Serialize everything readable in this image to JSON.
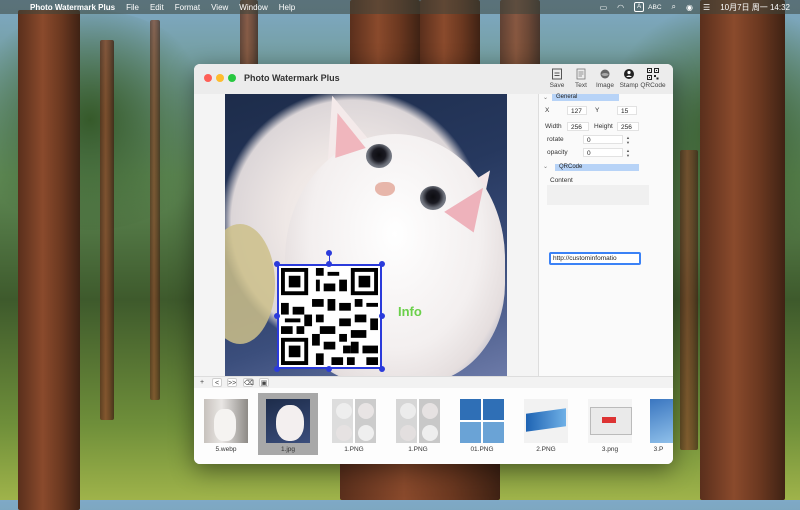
{
  "menubar": {
    "app_name": "Photo Watermark Plus",
    "menus": [
      "File",
      "Edit",
      "Format",
      "View",
      "Window",
      "Help"
    ],
    "input_source": "ABC",
    "clock": "10月7日 周一  14:32"
  },
  "window": {
    "title": "Photo Watermark Plus",
    "toolbar": [
      {
        "label": "Save",
        "icon": "save-icon"
      },
      {
        "label": "Text",
        "icon": "text-icon"
      },
      {
        "label": "Image",
        "icon": "image-icon"
      },
      {
        "label": "Stamp",
        "icon": "stamp-icon"
      },
      {
        "label": "QRCode",
        "icon": "qrcode-icon"
      }
    ]
  },
  "canvas": {
    "watermark_text": "Info",
    "watermark_text_color": "#6bd04a",
    "selection_color": "#2b3bdb"
  },
  "panel": {
    "general": {
      "header": "General",
      "x_label": "X",
      "x_value": "127",
      "y_label": "Y",
      "y_value": "15",
      "width_label": "Width",
      "width_value": "256",
      "height_label": "Height",
      "height_value": "256",
      "rotate_label": "rotate",
      "rotate_value": "0",
      "opacity_label": "opacity",
      "opacity_value": "0"
    },
    "qrcode": {
      "header": "QRCode",
      "content_label": "Content",
      "content_value": "http://custominfomatio"
    },
    "header_color": "#b7d3f7"
  },
  "nav": {
    "buttons": [
      "+",
      "<",
      ">>",
      "⌫",
      "▣"
    ]
  },
  "thumbnails": [
    {
      "caption": "5.webp",
      "selected": false
    },
    {
      "caption": "1.jpg",
      "selected": true
    },
    {
      "caption": "1.PNG",
      "selected": false
    },
    {
      "caption": "1.PNG",
      "selected": false
    },
    {
      "caption": "01.PNG",
      "selected": false
    },
    {
      "caption": "2.PNG",
      "selected": false
    },
    {
      "caption": "3.png",
      "selected": false
    },
    {
      "caption": "3.P",
      "selected": false
    }
  ]
}
